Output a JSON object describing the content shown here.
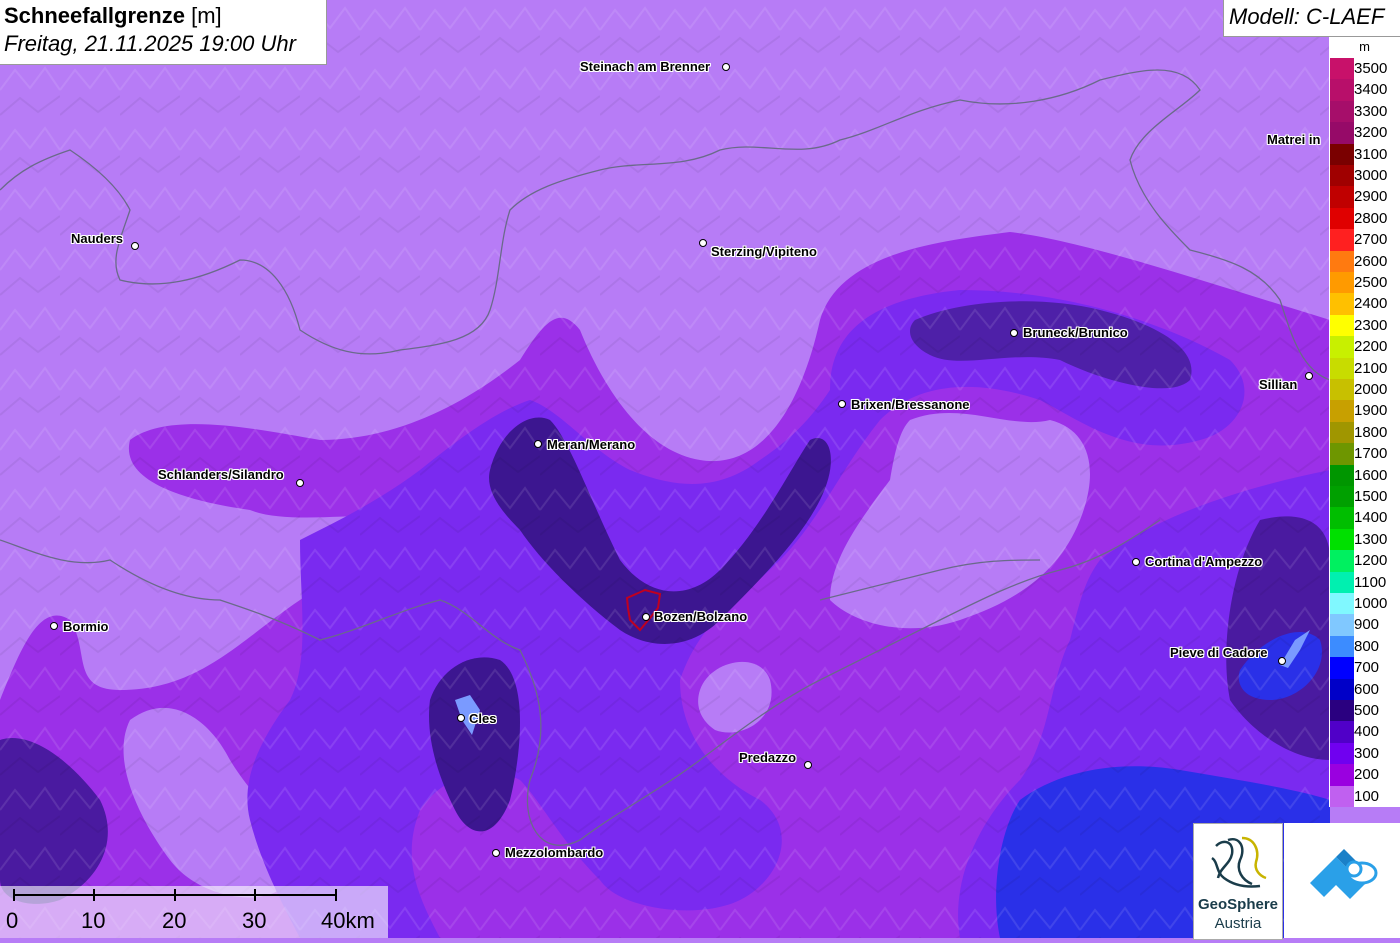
{
  "title": {
    "parameter": "Schneefallgrenze",
    "unit": "[m]",
    "datetime": "Freitag, 21.11.2025 19:00 Uhr"
  },
  "model": "Modell: C-LAEF",
  "legend": {
    "unit": "m",
    "entries": [
      {
        "label": "3500",
        "color": "#c8116a"
      },
      {
        "label": "3400",
        "color": "#b80f6a"
      },
      {
        "label": "3300",
        "color": "#a60e6a"
      },
      {
        "label": "3200",
        "color": "#960a68"
      },
      {
        "label": "3100",
        "color": "#7a0000"
      },
      {
        "label": "3000",
        "color": "#a00000"
      },
      {
        "label": "2900",
        "color": "#c00000"
      },
      {
        "label": "2800",
        "color": "#e00000"
      },
      {
        "label": "2700",
        "color": "#ff2020"
      },
      {
        "label": "2600",
        "color": "#ff7a10"
      },
      {
        "label": "2500",
        "color": "#ff9a00"
      },
      {
        "label": "2400",
        "color": "#ffc000"
      },
      {
        "label": "2300",
        "color": "#ffff00"
      },
      {
        "label": "2200",
        "color": "#c8f000"
      },
      {
        "label": "2100",
        "color": "#c8dc00"
      },
      {
        "label": "2000",
        "color": "#c8c000"
      },
      {
        "label": "1900",
        "color": "#c8a000"
      },
      {
        "label": "1800",
        "color": "#a09600"
      },
      {
        "label": "1700",
        "color": "#6e9600"
      },
      {
        "label": "1600",
        "color": "#009600"
      },
      {
        "label": "1500",
        "color": "#00a000"
      },
      {
        "label": "1400",
        "color": "#00be00"
      },
      {
        "label": "1300",
        "color": "#00e000"
      },
      {
        "label": "1200",
        "color": "#00f060"
      },
      {
        "label": "1100",
        "color": "#00f0b0"
      },
      {
        "label": "1000",
        "color": "#80f8ff"
      },
      {
        "label": "900",
        "color": "#80c8ff"
      },
      {
        "label": "800",
        "color": "#3c8cff"
      },
      {
        "label": "700",
        "color": "#0000ff"
      },
      {
        "label": "600",
        "color": "#0000c8"
      },
      {
        "label": "500",
        "color": "#2a0080"
      },
      {
        "label": "400",
        "color": "#5000c8"
      },
      {
        "label": "300",
        "color": "#7000f0"
      },
      {
        "label": "200",
        "color": "#9a00e0"
      },
      {
        "label": "100",
        "color": "#c060f0"
      }
    ]
  },
  "cities": [
    {
      "name": "Steinach am Brenner"
    },
    {
      "name": "Matrei in"
    },
    {
      "name": "Nauders"
    },
    {
      "name": "Sterzing/Vipiteno"
    },
    {
      "name": "Bruneck/Brunico"
    },
    {
      "name": "Sillian"
    },
    {
      "name": "Brixen/Bressanone"
    },
    {
      "name": "Meran/Merano"
    },
    {
      "name": "Schlanders/Silandro"
    },
    {
      "name": "Cortina d'Ampezzo"
    },
    {
      "name": "Bormio"
    },
    {
      "name": "Bozen/Bolzano"
    },
    {
      "name": "Pieve di Cadore"
    },
    {
      "name": "Cles"
    },
    {
      "name": "Predazzo"
    },
    {
      "name": "Mezzolombardo"
    }
  ],
  "scale": {
    "labels": [
      "0",
      "10",
      "20",
      "30",
      "40km"
    ]
  },
  "logos": {
    "geosphere_line1": "GeoSphere",
    "geosphere_line2": "Austria"
  },
  "colors": {
    "zone_100": "#b77cf6",
    "zone_200": "#9b30e8",
    "zone_300": "#7a2af0",
    "zone_400": "#5a18c8",
    "zone_500": "#3c1690",
    "zone_700": "#2a30e8"
  }
}
